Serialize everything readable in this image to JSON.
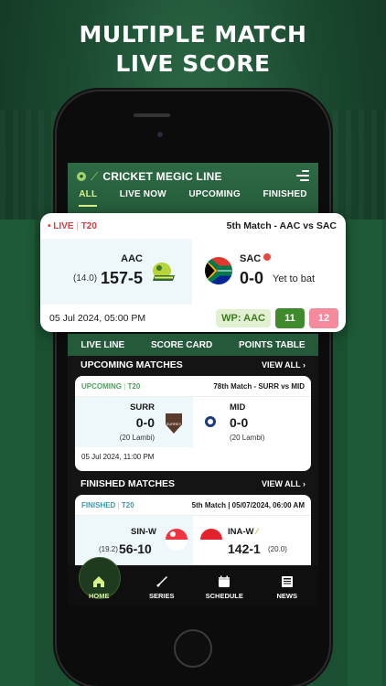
{
  "promo": {
    "line1": "MULTIPLE MATCH",
    "line2": "LIVE SCORE"
  },
  "app": {
    "title": "CRICKET MEGIC LINE",
    "tabs": [
      "ALL",
      "LIVE NOW",
      "UPCOMING",
      "FINISHED"
    ],
    "active_tab": "ALL"
  },
  "live_match": {
    "status": "LIVE",
    "format": "T20",
    "title": "5th Match - AAC vs SAC",
    "team_a": {
      "abbr": "AAC",
      "overs": "(14.0)",
      "score": "157-5"
    },
    "team_b": {
      "abbr": "SAC",
      "score": "0-0",
      "note": "Yet to bat"
    },
    "datetime": "05 Jul 2024, 05:00 PM",
    "wp_label": "WP: AAC",
    "wp_a": "11",
    "wp_b": "12"
  },
  "subnav": [
    "LIVE LINE",
    "SCORE CARD",
    "POINTS TABLE"
  ],
  "upcoming": {
    "heading": "UPCOMING MATCHES",
    "view_all": "VIEW ALL",
    "card": {
      "status": "UPCOMING",
      "format": "T20",
      "title": "78th Match - SURR vs MID",
      "team_a": {
        "abbr": "SURR",
        "score": "0-0",
        "note": "(20 Lambi)"
      },
      "team_b": {
        "abbr": "MID",
        "score": "0-0",
        "note": "(20 Lambi)"
      },
      "datetime": "05 Jul 2024, 11:00 PM"
    }
  },
  "finished": {
    "heading": "FINISHED MATCHES",
    "view_all": "VIEW ALL",
    "card": {
      "status": "FINISHED",
      "format": "T20",
      "title": "5th Match | 05/07/2024, 06:00 AM",
      "team_a": {
        "abbr": "SIN-W",
        "overs": "(19.2)",
        "score": "56-10"
      },
      "team_b": {
        "abbr": "INA-W",
        "score": "142-1",
        "overs": "(20.0)"
      }
    }
  },
  "bottom_nav": {
    "items": [
      "HOME",
      "SERIES",
      "SCHEDULE",
      "NEWS"
    ],
    "active": "HOME"
  },
  "colors": {
    "brand_green": "#2e6a45",
    "accent_lime": "#d8f28a",
    "live_red": "#e33a3a",
    "upcoming_green": "#4aa35a"
  }
}
